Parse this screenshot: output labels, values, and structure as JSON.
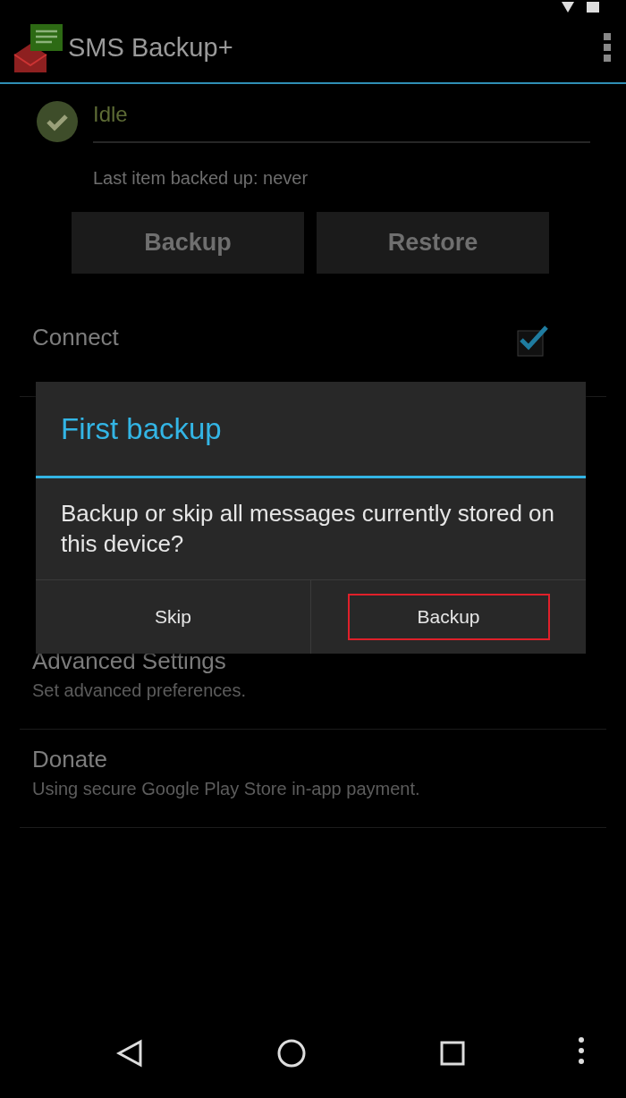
{
  "app_bar": {
    "title": "SMS Backup+"
  },
  "status": {
    "label": "Idle",
    "last_item": "Last item backed up: never"
  },
  "actions": [
    {
      "label": "Backup"
    },
    {
      "label": "Restore"
    }
  ],
  "settings": [
    {
      "kind": "checkbox",
      "title": "Connect",
      "checked": true
    },
    {
      "kind": "hidden"
    },
    {
      "kind": "plain",
      "title": "Advanced Settings",
      "summary": "Set advanced preferences."
    },
    {
      "kind": "plain",
      "title": "Donate",
      "summary": "Using secure Google Play Store in-app payment."
    }
  ],
  "dialog": {
    "title": "First backup",
    "message": "Backup or skip all messages currently stored on this device?",
    "buttons": [
      {
        "label": "Skip",
        "highlighted": false
      },
      {
        "label": "Backup",
        "highlighted": true
      }
    ]
  }
}
